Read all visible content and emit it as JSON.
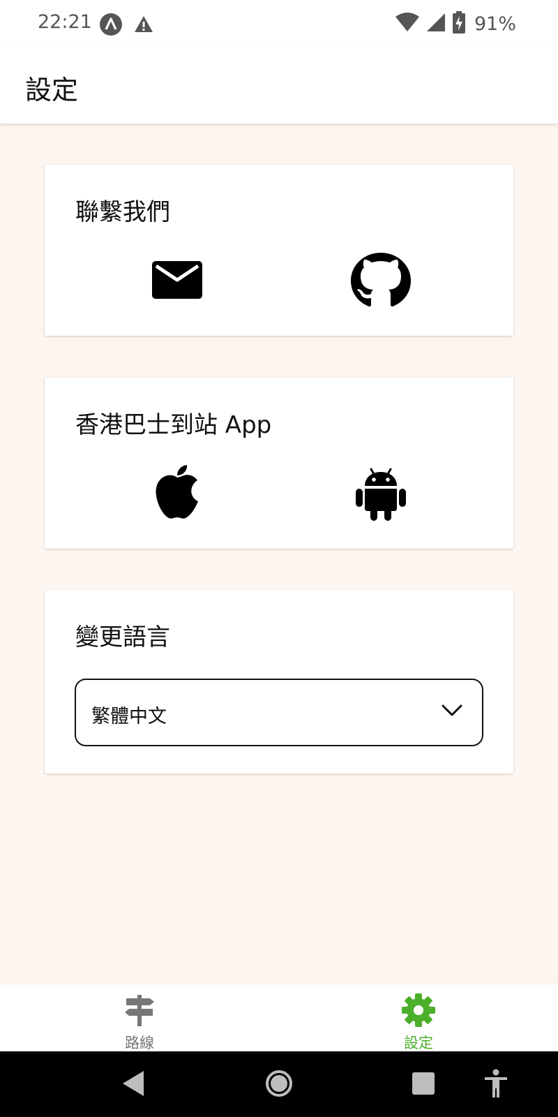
{
  "status_bar": {
    "time": "22:21",
    "battery": "91%",
    "icons": [
      "app-notification-icon",
      "warning-icon",
      "wifi-icon",
      "signal-icon",
      "battery-charging-icon"
    ]
  },
  "app_bar": {
    "title": "設定"
  },
  "contact_card": {
    "title": "聯繫我們",
    "icons": [
      "mail-icon",
      "github-icon"
    ]
  },
  "app_card": {
    "title": "香港巴士到站 App",
    "icons": [
      "apple-icon",
      "android-icon"
    ]
  },
  "language_card": {
    "title": "變更語言",
    "selected_language": "繁體中文"
  },
  "bottom_nav": {
    "items": [
      {
        "label": "路線",
        "icon": "signpost-icon",
        "active": false
      },
      {
        "label": "設定",
        "icon": "gear-icon",
        "active": true
      }
    ],
    "active_color": "#4caf2a",
    "inactive_color": "#777777"
  },
  "system_nav": {
    "buttons": [
      "back-icon",
      "home-icon",
      "recents-icon",
      "accessibility-icon"
    ]
  }
}
